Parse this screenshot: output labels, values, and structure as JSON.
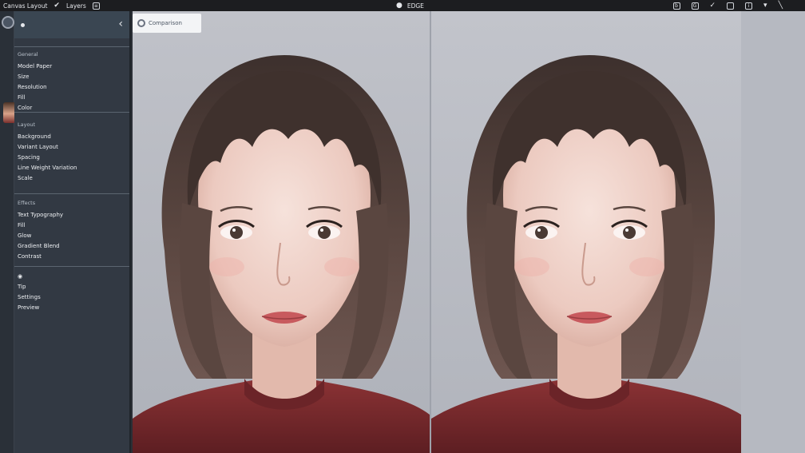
{
  "topbar": {
    "app_label": "Canvas Layout",
    "check_icon": "check-icon",
    "check_label": "Layers",
    "center_label": "EDGE",
    "right_icons": [
      "bold-icon",
      "grid-icon",
      "check-icon",
      "frame-icon",
      "info-icon",
      "dropdown-icon",
      "slash-icon"
    ]
  },
  "sidebar": {
    "sections": [
      {
        "title": "General",
        "items": [
          "Model Paper",
          "Size",
          "Resolution",
          "Fill",
          "Color"
        ]
      },
      {
        "title": "Layout",
        "items": [
          "Background",
          "Variant Layout",
          "Spacing",
          "Line Weight Variation",
          "Scale"
        ]
      },
      {
        "title": "Effects",
        "items": [
          "Text Typography",
          "Fill",
          "Glow",
          "Gradient Blend",
          "Contrast"
        ]
      },
      {
        "title": "",
        "items": [
          "Tip",
          "Settings",
          "Preview"
        ]
      }
    ]
  },
  "canvas": {
    "chip_label": "Comparison"
  },
  "colors": {
    "topbar_bg": "#1c1d20",
    "sidebar_bg": "#323943",
    "canvas_bg": "#b9bcc4",
    "hair": "#4a3a36",
    "sweater": "#7a2a2c"
  }
}
